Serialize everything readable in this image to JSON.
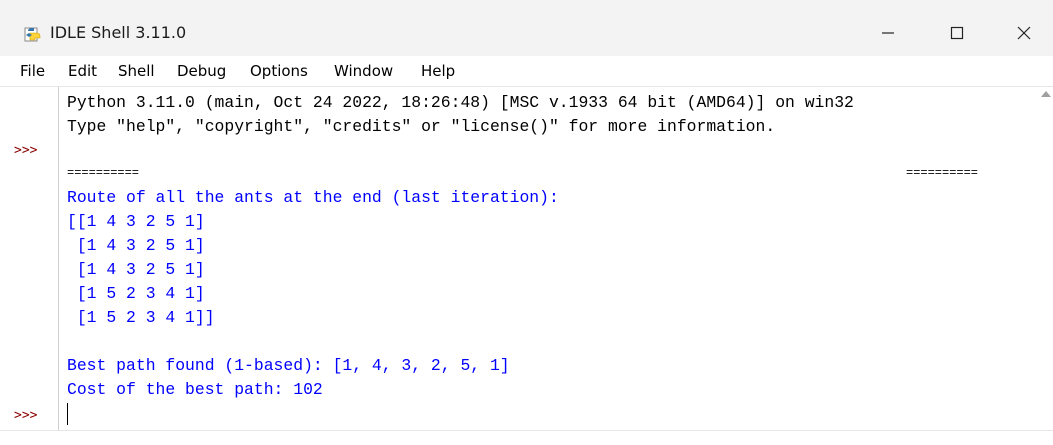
{
  "window": {
    "title": "IDLE Shell 3.11.0",
    "menu": [
      "File",
      "Edit",
      "Shell",
      "Debug",
      "Options",
      "Window",
      "Help"
    ]
  },
  "shell": {
    "prompt": ">>>",
    "lines": [
      "Python 3.11.0 (main, Oct 24 2022, 18:26:48) [MSC v.1933 64 bit (AMD64)] on win32",
      "Type \"help\", \"copyright\", \"credits\" or \"license()\" for more information.",
      "==========",
      "==========",
      "Route of all the ants at the end (last iteration):",
      "[[1 4 3 2 5 1]",
      " [1 4 3 2 5 1]",
      " [1 4 3 2 5 1]",
      " [1 5 2 3 4 1]",
      " [1 5 2 3 4 1]]",
      "Best path found (1-based): [1, 4, 3, 2, 5, 1]",
      "Cost of the best path: 102"
    ]
  },
  "colors": {
    "stdout": "#0000ff",
    "prompt": "#8b0000",
    "titlebar": "#f3f3f3"
  }
}
